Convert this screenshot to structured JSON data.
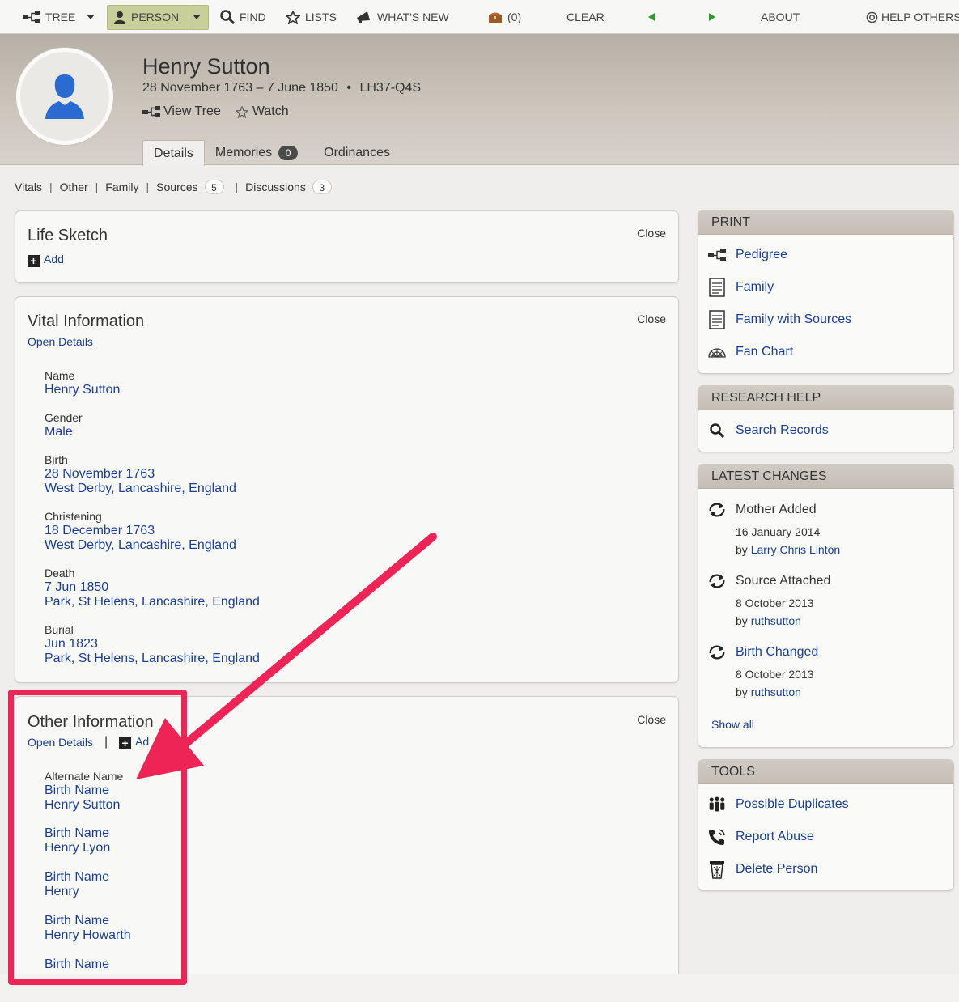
{
  "nav": {
    "tree": "TREE",
    "person": "PERSON",
    "find": "FIND",
    "lists": "LISTS",
    "whats_new": "WHAT'S NEW",
    "cart_count": "(0)",
    "clear": "CLEAR",
    "about": "ABOUT",
    "help_others": "HELP OTHERS"
  },
  "person": {
    "name": "Henry Sutton",
    "lifespan": "28 November 1763 – 7 June 1850",
    "bullet": "•",
    "pid": "LH37-Q4S",
    "view_tree": "View Tree",
    "watch": "Watch"
  },
  "tabs": [
    {
      "label": "Details",
      "active": true
    },
    {
      "label": "Memories",
      "count": "0"
    },
    {
      "label": "Ordinances"
    }
  ],
  "subnav": {
    "vitals": "Vitals",
    "other": "Other",
    "family": "Family",
    "sources": "Sources",
    "sources_count": "5",
    "discussions": "Discussions",
    "discussions_count": "3",
    "sep": "|"
  },
  "life_sketch": {
    "title": "Life Sketch",
    "close": "Close",
    "add": "Add"
  },
  "vital": {
    "title": "Vital Information",
    "close": "Close",
    "open_details": "Open Details",
    "fields": [
      {
        "label": "Name",
        "values": [
          "Henry Sutton"
        ]
      },
      {
        "label": "Gender",
        "values": [
          "Male"
        ]
      },
      {
        "label": "Birth",
        "values": [
          "28 November 1763",
          "West Derby, Lancashire, England"
        ]
      },
      {
        "label": "Christening",
        "values": [
          "18 December 1763",
          "West Derby, Lancashire, England"
        ]
      },
      {
        "label": "Death",
        "values": [
          "7 Jun 1850",
          "Park, St Helens, Lancashire, England"
        ]
      },
      {
        "label": "Burial",
        "values": [
          "Jun 1823",
          "Park, St Helens, Lancashire, England"
        ]
      }
    ]
  },
  "other": {
    "title": "Other Information",
    "close": "Close",
    "open_details": "Open Details",
    "sep": "|",
    "add_partial": "Ad",
    "alt_label": "Alternate Name",
    "names": [
      {
        "type": "Birth Name",
        "value": "Henry Sutton"
      },
      {
        "type": "Birth Name",
        "value": "Henry Lyon"
      },
      {
        "type": "Birth Name",
        "value": "Henry"
      },
      {
        "type": "Birth Name",
        "value": "Henry Howarth"
      },
      {
        "type": "Birth Name",
        "value": ""
      }
    ]
  },
  "print": {
    "title": "PRINT",
    "items": [
      "Pedigree",
      "Family",
      "Family with Sources",
      "Fan Chart"
    ]
  },
  "research": {
    "title": "RESEARCH HELP",
    "items": [
      "Search Records"
    ]
  },
  "changes": {
    "title": "LATEST CHANGES",
    "items": [
      {
        "title": "Mother Added",
        "date": "16 January 2014",
        "by": "by",
        "user": "Larry Chris Linton"
      },
      {
        "title": "Source Attached",
        "date": "8 October 2013",
        "by": "by",
        "user": "ruthsutton"
      },
      {
        "title": "Birth Changed",
        "date": "8 October 2013",
        "by": "by",
        "user": "ruthsutton"
      }
    ],
    "show_all": "Show all"
  },
  "tools": {
    "title": "TOOLS",
    "items": [
      "Possible Duplicates",
      "Report Abuse",
      "Delete Person"
    ]
  },
  "colors": {
    "link": "#1c3f94",
    "highlight": "#ee2456",
    "person_pill": "#c8cf9a"
  }
}
